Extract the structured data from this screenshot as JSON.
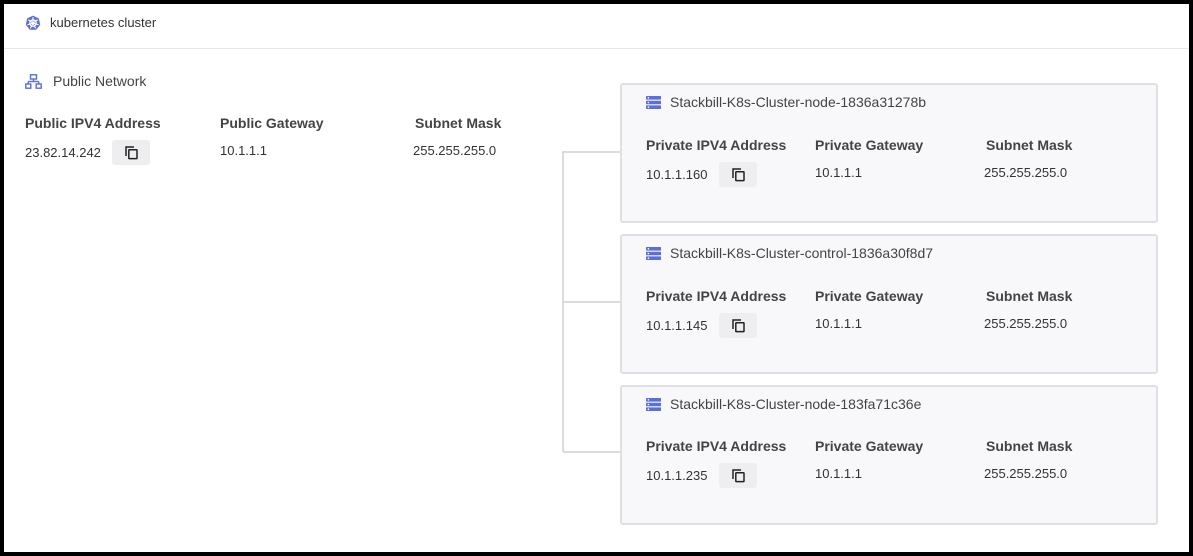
{
  "header": {
    "title": "kubernetes cluster",
    "icon": "kubernetes-icon"
  },
  "public_network": {
    "title": "Public Network",
    "icon": "network-icon",
    "columns": {
      "address_label": "Public IPV4 Address",
      "gateway_label": "Public Gateway",
      "subnet_label": "Subnet Mask"
    },
    "address": "23.82.14.242",
    "gateway": "10.1.1.1",
    "subnet": "255.255.255.0"
  },
  "nodes": [
    {
      "name": "Stackbill-K8s-Cluster-node-1836a31278b",
      "address_label": "Private IPV4 Address",
      "gateway_label": "Private Gateway",
      "subnet_label": "Subnet Mask",
      "address": "10.1.1.160",
      "gateway": "10.1.1.1",
      "subnet": "255.255.255.0"
    },
    {
      "name": "Stackbill-K8s-Cluster-control-1836a30f8d7",
      "address_label": "Private IPV4 Address",
      "gateway_label": "Private Gateway",
      "subnet_label": "Subnet Mask",
      "address": "10.1.1.145",
      "gateway": "10.1.1.1",
      "subnet": "255.255.255.0"
    },
    {
      "name": "Stackbill-K8s-Cluster-node-183fa71c36e",
      "address_label": "Private IPV4 Address",
      "gateway_label": "Private Gateway",
      "subnet_label": "Subnet Mask",
      "address": "10.1.1.235",
      "gateway": "10.1.1.1",
      "subnet": "255.255.255.0"
    }
  ],
  "colors": {
    "accent": "#5b6fd6",
    "card_bg": "#f8f8fa",
    "card_border": "#dfe0e3",
    "button_bg": "#eeeef0",
    "connector": "#d0d0d0"
  }
}
